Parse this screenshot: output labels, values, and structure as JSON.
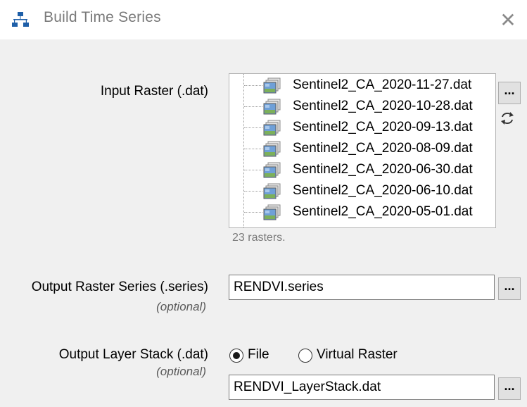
{
  "window": {
    "title": "Build Time Series",
    "close_glyph": "✕"
  },
  "input_raster": {
    "label": "Input Raster (.dat)",
    "files": [
      "Sentinel2_CA_2020-11-27.dat",
      "Sentinel2_CA_2020-10-28.dat",
      "Sentinel2_CA_2020-09-13.dat",
      "Sentinel2_CA_2020-08-09.dat",
      "Sentinel2_CA_2020-06-30.dat",
      "Sentinel2_CA_2020-06-10.dat",
      "Sentinel2_CA_2020-05-01.dat"
    ],
    "count_text": "23 rasters.",
    "browse_label": "...",
    "refresh_icon": "refresh-icon",
    "file_icon": "raster-file-icon"
  },
  "output_series": {
    "label": "Output Raster Series (.series)",
    "optional": "(optional)",
    "value": "RENDVI.series",
    "browse_label": "..."
  },
  "output_stack": {
    "label": "Output Layer Stack (.dat)",
    "optional": "(optional)",
    "radio_file": "File",
    "radio_virtual": "Virtual Raster",
    "selected": "File",
    "value": "RENDVI_LayerStack.dat",
    "browse_label": "..."
  },
  "colors": {
    "accent_blue": "#1e5fa8",
    "background": "#f0f0f0"
  }
}
